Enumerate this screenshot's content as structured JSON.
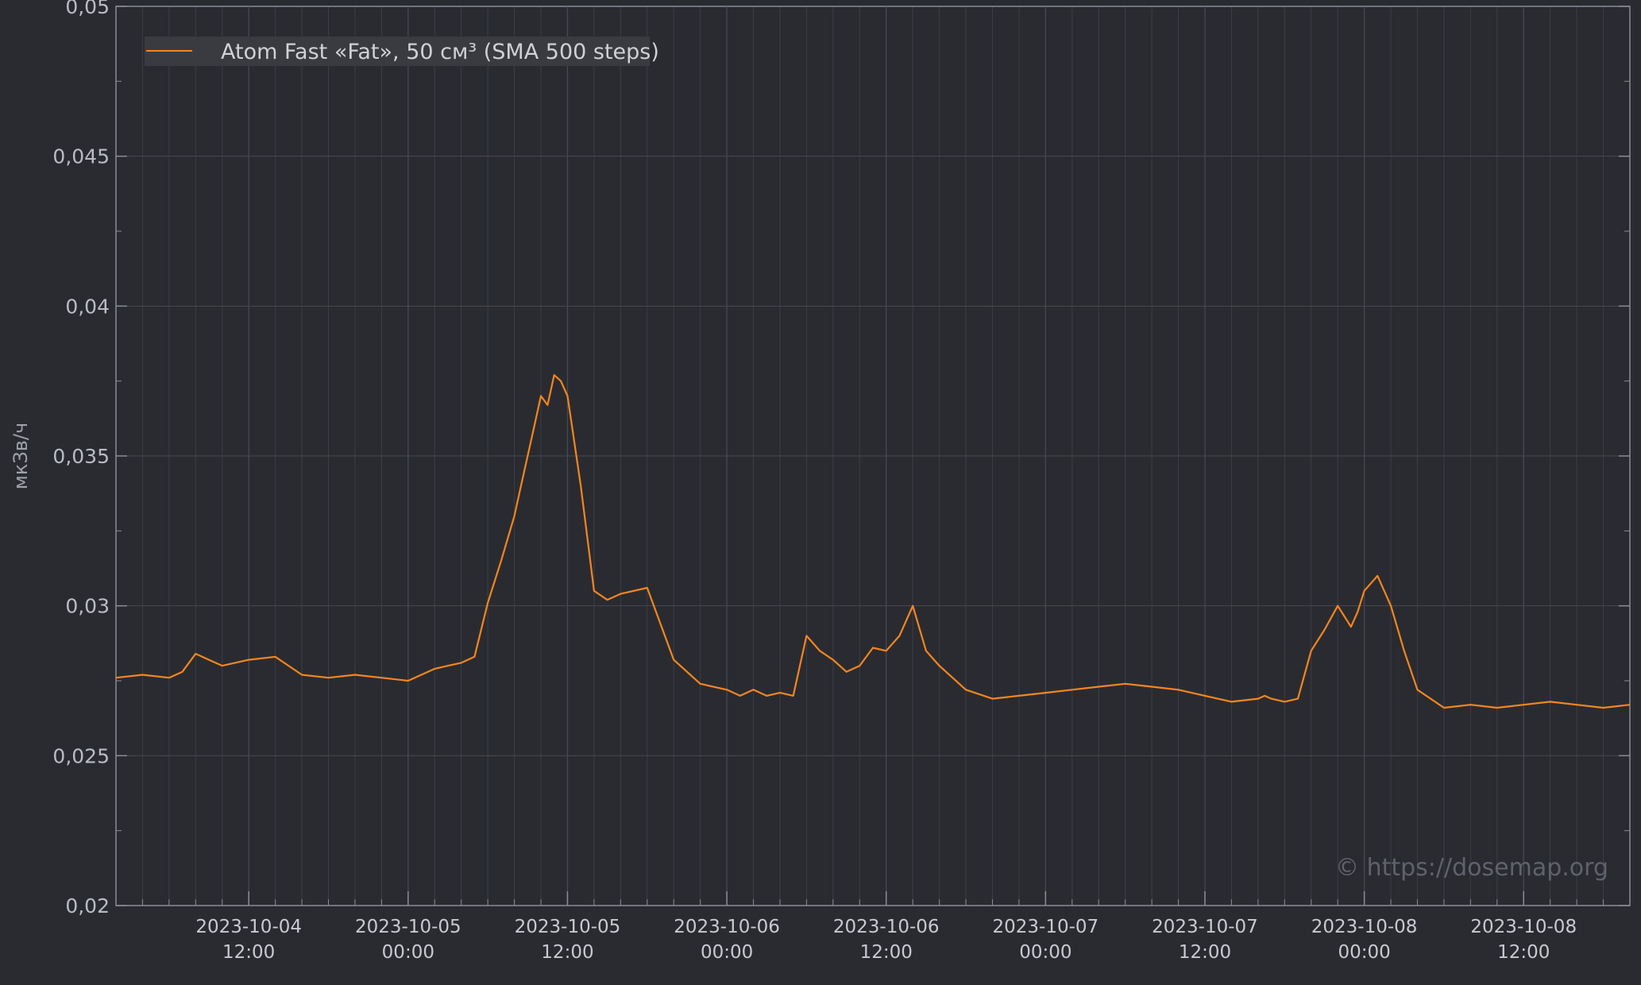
{
  "chart_data": {
    "type": "line",
    "title": "",
    "xlabel": "",
    "ylabel": "мкЗв/ч",
    "ylim": [
      0.02,
      0.05
    ],
    "xlim": [
      "2023-10-04T02:00",
      "2023-10-08T20:00"
    ],
    "y_ticks": [
      "0,02",
      "0,025",
      "0,03",
      "0,035",
      "0,04",
      "0,045",
      "0,05"
    ],
    "y_tick_values": [
      0.02,
      0.025,
      0.03,
      0.035,
      0.04,
      0.045,
      0.05
    ],
    "x_ticks": [
      {
        "t": "2023-10-04T12:00",
        "date": "2023-10-04",
        "time": "12:00"
      },
      {
        "t": "2023-10-05T00:00",
        "date": "2023-10-05",
        "time": "00:00"
      },
      {
        "t": "2023-10-05T12:00",
        "date": "2023-10-05",
        "time": "12:00"
      },
      {
        "t": "2023-10-06T00:00",
        "date": "2023-10-06",
        "time": "00:00"
      },
      {
        "t": "2023-10-06T12:00",
        "date": "2023-10-06",
        "time": "12:00"
      },
      {
        "t": "2023-10-07T00:00",
        "date": "2023-10-07",
        "time": "00:00"
      },
      {
        "t": "2023-10-07T12:00",
        "date": "2023-10-07",
        "time": "12:00"
      },
      {
        "t": "2023-10-08T00:00",
        "date": "2023-10-08",
        "time": "00:00"
      },
      {
        "t": "2023-10-08T12:00",
        "date": "2023-10-08",
        "time": "12:00"
      }
    ],
    "grid": true,
    "legend_position": "top-left",
    "watermark": "© https://dosemap.org",
    "colors": {
      "background": "#2a2b31",
      "line": "#f5861f",
      "grid": "#474a52",
      "axis": "#8a8d95"
    },
    "series": [
      {
        "name": "Atom Fast «Fat», 50 см³ (SMA 500 steps)",
        "x": [
          "2023-10-04T02:00",
          "2023-10-04T04:00",
          "2023-10-04T06:00",
          "2023-10-04T07:00",
          "2023-10-04T08:00",
          "2023-10-04T09:00",
          "2023-10-04T10:00",
          "2023-10-04T12:00",
          "2023-10-04T14:00",
          "2023-10-04T16:00",
          "2023-10-04T18:00",
          "2023-10-04T20:00",
          "2023-10-04T22:00",
          "2023-10-05T00:00",
          "2023-10-05T02:00",
          "2023-10-05T03:00",
          "2023-10-05T04:00",
          "2023-10-05T05:00",
          "2023-10-05T06:00",
          "2023-10-05T07:00",
          "2023-10-05T08:00",
          "2023-10-05T08:30",
          "2023-10-05T09:00",
          "2023-10-05T09:30",
          "2023-10-05T10:00",
          "2023-10-05T10:30",
          "2023-10-05T11:00",
          "2023-10-05T11:30",
          "2023-10-05T12:00",
          "2023-10-05T13:00",
          "2023-10-05T14:00",
          "2023-10-05T15:00",
          "2023-10-05T16:00",
          "2023-10-05T18:00",
          "2023-10-05T20:00",
          "2023-10-05T22:00",
          "2023-10-06T00:00",
          "2023-10-06T01:00",
          "2023-10-06T02:00",
          "2023-10-06T03:00",
          "2023-10-06T04:00",
          "2023-10-06T05:00",
          "2023-10-06T06:00",
          "2023-10-06T07:00",
          "2023-10-06T08:00",
          "2023-10-06T09:00",
          "2023-10-06T10:00",
          "2023-10-06T11:00",
          "2023-10-06T12:00",
          "2023-10-06T13:00",
          "2023-10-06T14:00",
          "2023-10-06T15:00",
          "2023-10-06T16:00",
          "2023-10-06T18:00",
          "2023-10-06T20:00",
          "2023-10-06T22:00",
          "2023-10-07T00:00",
          "2023-10-07T02:00",
          "2023-10-07T04:00",
          "2023-10-07T06:00",
          "2023-10-07T08:00",
          "2023-10-07T10:00",
          "2023-10-07T12:00",
          "2023-10-07T14:00",
          "2023-10-07T16:00",
          "2023-10-07T16:30",
          "2023-10-07T17:00",
          "2023-10-07T18:00",
          "2023-10-07T19:00",
          "2023-10-07T20:00",
          "2023-10-07T21:00",
          "2023-10-07T22:00",
          "2023-10-07T23:00",
          "2023-10-07T23:30",
          "2023-10-08T00:00",
          "2023-10-08T01:00",
          "2023-10-08T02:00",
          "2023-10-08T03:00",
          "2023-10-08T04:00",
          "2023-10-08T06:00",
          "2023-10-08T08:00",
          "2023-10-08T10:00",
          "2023-10-08T12:00",
          "2023-10-08T14:00",
          "2023-10-08T16:00",
          "2023-10-08T18:00",
          "2023-10-08T20:00"
        ],
        "values": [
          0.0276,
          0.0277,
          0.0276,
          0.0278,
          0.0284,
          0.0282,
          0.028,
          0.0282,
          0.0283,
          0.0277,
          0.0276,
          0.0277,
          0.0276,
          0.0275,
          0.0279,
          0.028,
          0.0281,
          0.0283,
          0.0301,
          0.0315,
          0.033,
          0.034,
          0.035,
          0.036,
          0.037,
          0.0367,
          0.0377,
          0.0375,
          0.037,
          0.034,
          0.0305,
          0.0302,
          0.0304,
          0.0306,
          0.0282,
          0.0274,
          0.0272,
          0.027,
          0.0272,
          0.027,
          0.0271,
          0.027,
          0.029,
          0.0285,
          0.0282,
          0.0278,
          0.028,
          0.0286,
          0.0285,
          0.029,
          0.03,
          0.0285,
          0.028,
          0.0272,
          0.0269,
          0.027,
          0.0271,
          0.0272,
          0.0273,
          0.0274,
          0.0273,
          0.0272,
          0.027,
          0.0268,
          0.0269,
          0.027,
          0.0269,
          0.0268,
          0.0269,
          0.0285,
          0.0292,
          0.03,
          0.0293,
          0.0298,
          0.0305,
          0.031,
          0.03,
          0.0285,
          0.0272,
          0.0266,
          0.0267,
          0.0266,
          0.0267,
          0.0268,
          0.0267,
          0.0266,
          0.0267
        ]
      }
    ]
  }
}
